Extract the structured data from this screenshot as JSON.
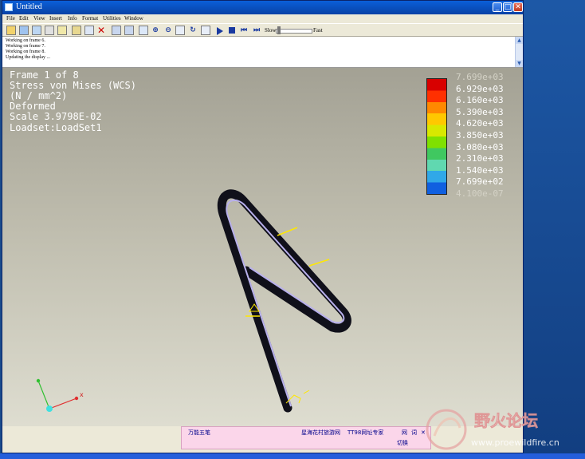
{
  "window": {
    "title": "Untitled",
    "controls": {
      "minimize": "_",
      "maximize": "□",
      "close": "✕"
    }
  },
  "menu": [
    "File",
    "Edit",
    "View",
    "Insert",
    "Info",
    "Format",
    "Utilities",
    "Window"
  ],
  "toolbar": {
    "icons": [
      "open-icon",
      "save-icon",
      "save-as-icon",
      "print-icon",
      "window-icon",
      "export-icon",
      "copy-icon",
      "delete-icon",
      "grid-icon",
      "tiles-icon",
      "frame-icon",
      "zoom-in-icon",
      "zoom-out-icon",
      "refit-icon",
      "spin-icon",
      "orient-icon",
      "play-icon",
      "stop-icon",
      "step-back-icon",
      "step-forward-icon"
    ],
    "speed_slow": "Slow",
    "speed_fast": "Fast",
    "speed_level": 0.05
  },
  "messages": [
    "Working on frame 6.",
    "Working on frame 7.",
    "Working on frame 8.",
    "Updating the display ..."
  ],
  "overlay": {
    "frame": "Frame 1 of 8",
    "quantity": "Stress von Mises (WCS)",
    "units": "(N / mm^2)",
    "mode": "Deformed",
    "scale": "Scale    3.9798E-02",
    "loadset": "Loadset:LoadSet1"
  },
  "legend": {
    "labels": [
      "7.699e+03",
      "6.929e+03",
      "6.160e+03",
      "5.390e+03",
      "4.620e+03",
      "3.850e+03",
      "3.080e+03",
      "2.310e+03",
      "1.540e+03",
      "7.699e+02",
      "4.100e-07"
    ],
    "colors": [
      "#d80000",
      "#ff3000",
      "#ff8800",
      "#ffc800",
      "#d8e800",
      "#80e000",
      "#40c860",
      "#60d8b0",
      "#30a8e8",
      "#1060e0",
      "#1010c8"
    ]
  },
  "triad": {
    "axis_x": "x"
  },
  "ime": {
    "name": "万能五笔",
    "link1": "星海花村旅游网",
    "link2": "TT98网址专家",
    "mode1": "网",
    "mode2": "词",
    "close": "✕",
    "switch": "切换"
  },
  "watermark": {
    "text_cn": "野火论坛",
    "url": "www.proewildfire.cn"
  }
}
